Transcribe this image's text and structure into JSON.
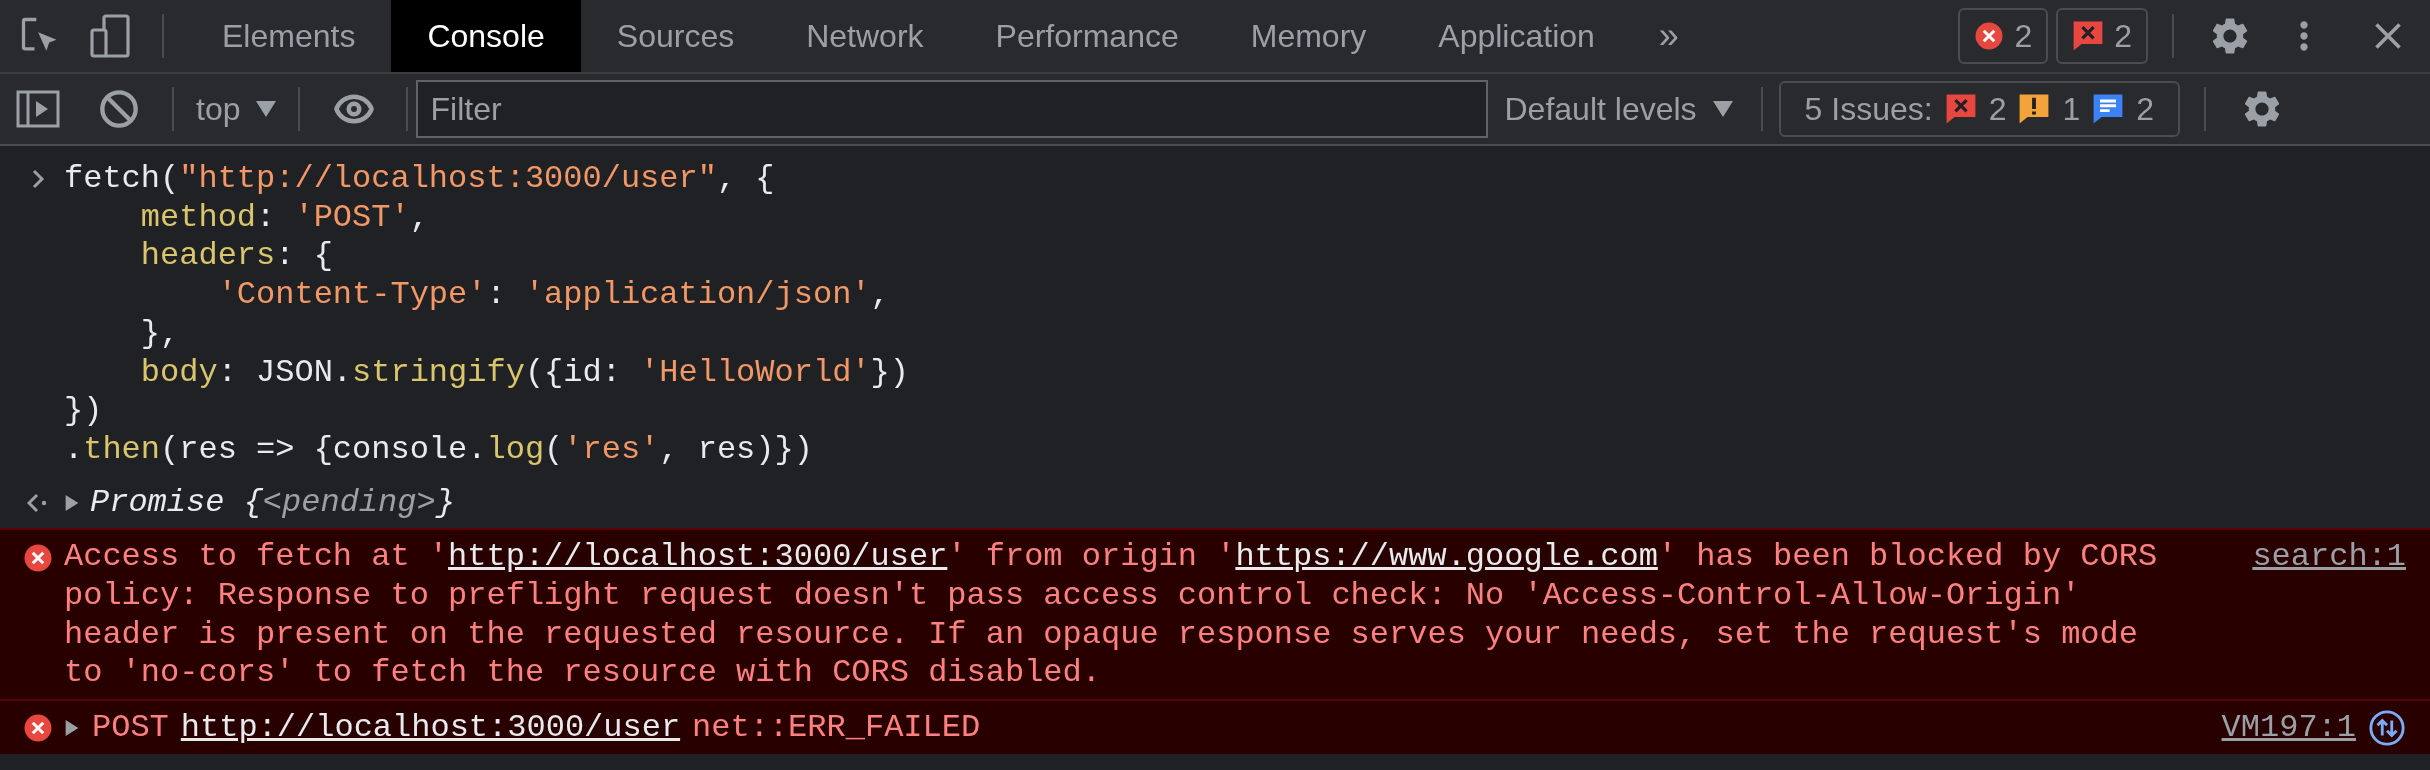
{
  "tabs": [
    {
      "label": "Elements",
      "selected": false
    },
    {
      "label": "Console",
      "selected": true
    },
    {
      "label": "Sources",
      "selected": false
    },
    {
      "label": "Network",
      "selected": false
    },
    {
      "label": "Performance",
      "selected": false
    },
    {
      "label": "Memory",
      "selected": false
    },
    {
      "label": "Application",
      "selected": false
    }
  ],
  "more_tabs": "»",
  "counters": [
    {
      "kind": "error",
      "count": "2"
    },
    {
      "kind": "issue",
      "count": "2"
    }
  ],
  "console_toolbar": {
    "context": "top",
    "filter": {
      "placeholder": "Filter"
    },
    "levels": "Default levels",
    "issues": {
      "label": "5 Issues:",
      "counts": [
        {
          "kind": "error",
          "count": "2"
        },
        {
          "kind": "warning",
          "count": "1"
        },
        {
          "kind": "info",
          "count": "2"
        }
      ]
    }
  },
  "entries": [
    {
      "kind": "input",
      "lines": [
        [
          {
            "kind": "plain",
            "text": "fetch("
          },
          {
            "kind": "string",
            "text": "\"http://localhost:3000/user\""
          },
          {
            "kind": "plain",
            "text": ", {"
          }
        ],
        [
          {
            "kind": "prop",
            "text": "    method"
          },
          {
            "kind": "plain",
            "text": ": "
          },
          {
            "kind": "string",
            "text": "'POST'"
          },
          {
            "kind": "plain",
            "text": ","
          }
        ],
        [
          {
            "kind": "prop",
            "text": "    headers"
          },
          {
            "kind": "plain",
            "text": ": {"
          }
        ],
        [
          {
            "kind": "string",
            "text": "        'Content-Type'"
          },
          {
            "kind": "plain",
            "text": ": "
          },
          {
            "kind": "string",
            "text": "'application/json'"
          },
          {
            "kind": "plain",
            "text": ","
          }
        ],
        [
          {
            "kind": "plain",
            "text": "    },"
          }
        ],
        [
          {
            "kind": "prop",
            "text": "    body"
          },
          {
            "kind": "plain",
            "text": ": JSON."
          },
          {
            "kind": "prop",
            "text": "stringify"
          },
          {
            "kind": "plain",
            "text": "({id: "
          },
          {
            "kind": "string",
            "text": "'HelloWorld'"
          },
          {
            "kind": "plain",
            "text": "})"
          }
        ],
        [
          {
            "kind": "plain",
            "text": "})"
          }
        ],
        [
          {
            "kind": "plain",
            "text": "."
          },
          {
            "kind": "prop",
            "text": "then"
          },
          {
            "kind": "plain",
            "text": "(res => {console."
          },
          {
            "kind": "prop",
            "text": "log"
          },
          {
            "kind": "plain",
            "text": "("
          },
          {
            "kind": "string",
            "text": "'res'"
          },
          {
            "kind": "plain",
            "text": ", res)})"
          }
        ]
      ]
    },
    {
      "kind": "result",
      "expanded": false,
      "parts": [
        {
          "kind": "plain",
          "text": "Promise {"
        },
        {
          "kind": "dim",
          "text": "<pending>"
        },
        {
          "kind": "plain",
          "text": "}"
        }
      ]
    },
    {
      "kind": "error",
      "source": "search:1",
      "message": [
        {
          "kind": "text",
          "text": "Access to fetch at '"
        },
        {
          "kind": "link",
          "text": "http://localhost:3000/user"
        },
        {
          "kind": "text",
          "text": "' from origin '"
        },
        {
          "kind": "link",
          "text": "https://www.google.com"
        },
        {
          "kind": "text",
          "text": "' has been blocked by CORS policy: Response to preflight request doesn't pass access control check: No 'Access-Control-Allow-Origin' header is present on the requested resource. If an opaque response serves your needs, set the request's mode to 'no-cors' to fetch the resource with CORS disabled."
        }
      ]
    },
    {
      "kind": "network_error",
      "expanded": false,
      "method": "POST",
      "url": "http://localhost:3000/user",
      "status": "net::ERR_FAILED",
      "source": "VM197:1"
    }
  ]
}
